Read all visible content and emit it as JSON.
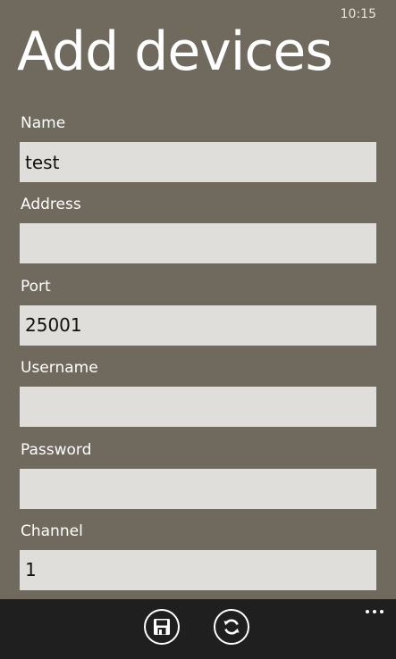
{
  "status_bar": {
    "time": "10:15"
  },
  "page": {
    "title": "Add devices"
  },
  "form": {
    "fields": [
      {
        "label": "Name",
        "value": "test"
      },
      {
        "label": "Address",
        "value": ""
      },
      {
        "label": "Port",
        "value": "25001"
      },
      {
        "label": "Username",
        "value": ""
      },
      {
        "label": "Password",
        "value": ""
      },
      {
        "label": "Channel",
        "value": "1"
      }
    ]
  },
  "app_bar": {
    "buttons": [
      {
        "icon": "save-icon"
      },
      {
        "icon": "refresh-icon"
      }
    ],
    "more_icon": "more-dots-icon"
  }
}
